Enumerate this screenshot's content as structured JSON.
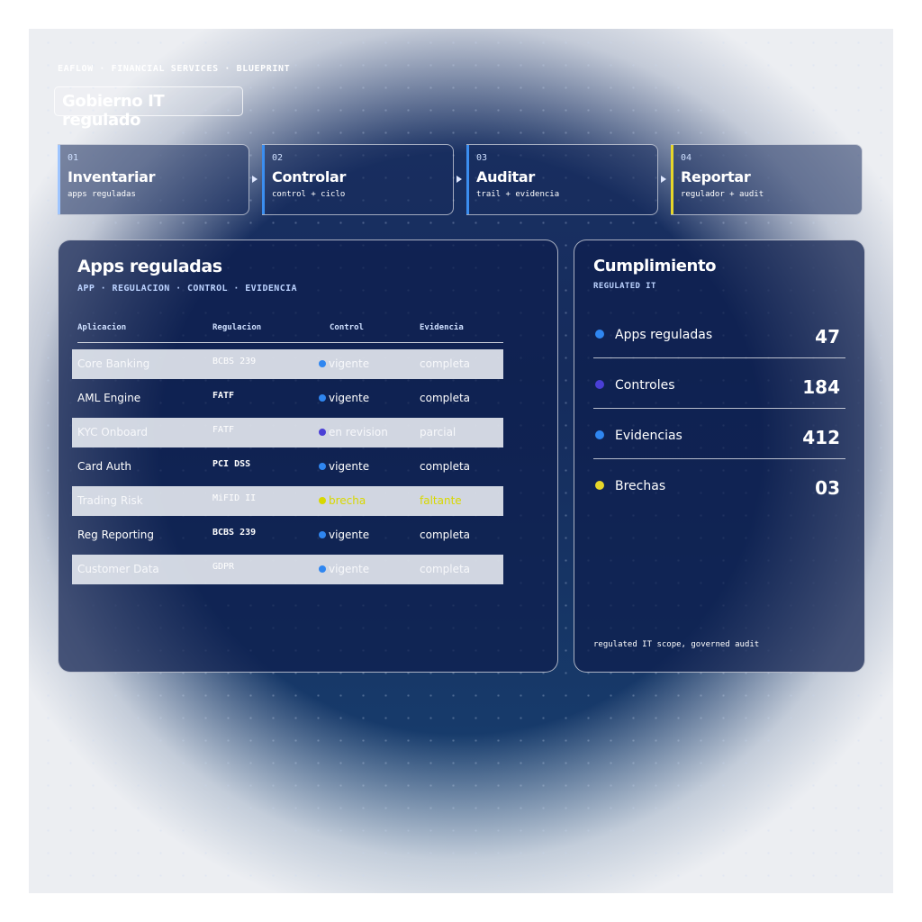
{
  "header": {
    "eyebrow": "EAFLOW · FINANCIAL SERVICES · BLUEPRINT",
    "title": "Gobierno IT regulado"
  },
  "steps": [
    {
      "num": "01",
      "name": "Inventariar",
      "sub": "apps reguladas",
      "color": "#9ec5ff"
    },
    {
      "num": "02",
      "name": "Controlar",
      "sub": "control + ciclo",
      "color": "#3b8ef0"
    },
    {
      "num": "03",
      "name": "Auditar",
      "sub": "trail + evidencia",
      "color": "#3b8ef0"
    },
    {
      "num": "04",
      "name": "Reportar",
      "sub": "regulador + audit",
      "color": "#e6d62a"
    }
  ],
  "apps_panel": {
    "title": "Apps reguladas",
    "subtitle": "APP · REGULACION · CONTROL · EVIDENCIA",
    "columns": [
      "Aplicacion",
      "Regulacion",
      "Control",
      "Evidencia"
    ],
    "rows": [
      {
        "app": "Core Banking",
        "regulation": "BCBS 239",
        "control": "vigente",
        "control_color": "#2f86f0",
        "evidence": "completa"
      },
      {
        "app": "AML Engine",
        "regulation": "FATF",
        "control": "vigente",
        "control_color": "#2f86f0",
        "evidence": "completa"
      },
      {
        "app": "KYC Onboard",
        "regulation": "FATF",
        "control": "en revision",
        "control_color": "#4a3fd6",
        "evidence": "parcial"
      },
      {
        "app": "Card Auth",
        "regulation": "PCI DSS",
        "control": "vigente",
        "control_color": "#2f86f0",
        "evidence": "completa"
      },
      {
        "app": "Trading Risk",
        "regulation": "MiFID II",
        "control": "brecha",
        "control_color": "#d8d800",
        "evidence": "faltante"
      },
      {
        "app": "Reg Reporting",
        "regulation": "BCBS 239",
        "control": "vigente",
        "control_color": "#2f86f0",
        "evidence": "completa"
      },
      {
        "app": "Customer Data",
        "regulation": "GDPR",
        "control": "vigente",
        "control_color": "#2f86f0",
        "evidence": "completa"
      }
    ]
  },
  "compliance_panel": {
    "title": "Cumplimiento",
    "subtitle": "REGULATED IT",
    "metrics": [
      {
        "label": "Apps reguladas",
        "value": "47",
        "color": "#2f86f0"
      },
      {
        "label": "Controles",
        "value": "184",
        "color": "#4a3fd6"
      },
      {
        "label": "Evidencias",
        "value": "412",
        "color": "#2f86f0"
      },
      {
        "label": "Brechas",
        "value": "03",
        "color": "#e6d62a"
      }
    ],
    "footnote": "regulated IT scope, governed audit"
  }
}
